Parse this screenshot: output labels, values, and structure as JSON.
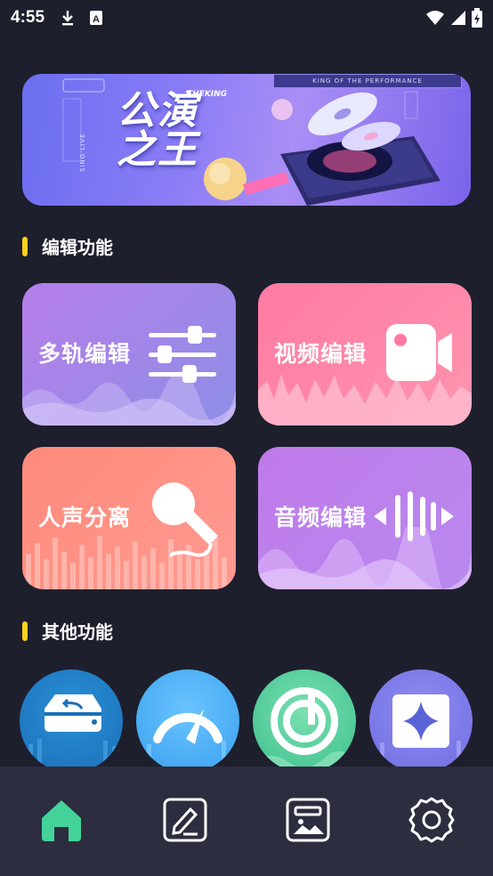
{
  "status_bar": {
    "time": "4:55",
    "left_icons": [
      "download-icon",
      "a-icon"
    ],
    "right_icons": [
      "wifi-icon",
      "signal-icon",
      "battery-charging-icon"
    ]
  },
  "banner": {
    "title": "公演之王",
    "subtitle": "THEKING",
    "top_tag": "KING OF THE PERFORMANCE",
    "side_text": "SING LIVE"
  },
  "sections": {
    "edit": "编辑功能",
    "other": "其他功能"
  },
  "cards": {
    "multitrack": "多轨编辑",
    "video": "视频编辑",
    "vocal": "人声分离",
    "audio": "音频编辑"
  },
  "other_functions": [
    "restore-icon",
    "speedometer-icon",
    "music-disc-icon",
    "sparkle-icon"
  ],
  "bottom_nav": [
    "home-icon",
    "edit-icon",
    "media-icon",
    "settings-icon"
  ],
  "colors": {
    "background": "#1d1f2d",
    "accent_yellow": "#ffd21e",
    "nav_bg": "#2c2e3f",
    "active_nav": "#43d39a"
  }
}
